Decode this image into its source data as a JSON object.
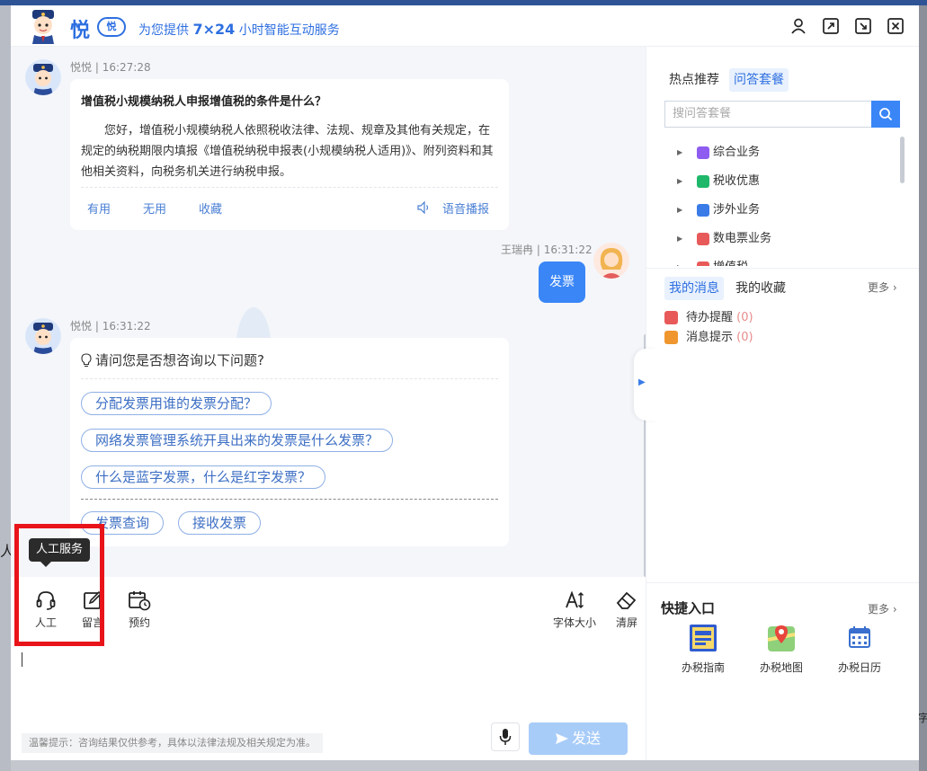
{
  "header": {
    "brand": "悦",
    "brand_badge": "悦",
    "tagline_pre": "为您提供",
    "tagline_bold": "7×24",
    "tagline_post": "小时智能互动服务"
  },
  "chat": {
    "messages": [
      {
        "sender": "悦悦",
        "time": "16:27:28",
        "question": "增值税小规模纳税人申报增值税的条件是什么？",
        "answer": "您好，增值税小规模纳税人依照税收法律、法规、规章及其他有关规定，在规定的纳税期限内填报《增值税纳税申报表(小规模纳税人适用)》、附列资料和其他相关资料，向税务机关进行纳税申报。",
        "actions": [
          "有用",
          "无用",
          "收藏"
        ],
        "voice_label": "语音播报"
      },
      {
        "sender": "王瑞冉",
        "time": "16:31:22",
        "text": "发票"
      },
      {
        "sender": "悦悦",
        "time": "16:31:22",
        "prompt": "请问您是否想咨询以下问题?",
        "suggestions": [
          "分配发票用谁的发票分配？",
          "网络发票管理系统开具出来的发票是什么发票？",
          "什么是蓝字发票，什么是红字发票？"
        ],
        "quick_chips": [
          "发票查询",
          "接收发票"
        ]
      }
    ]
  },
  "toolbar": {
    "left": [
      {
        "label": "人工",
        "icon": "headset-icon"
      },
      {
        "label": "留言",
        "icon": "edit-icon"
      },
      {
        "label": "预约",
        "icon": "calendar-clock-icon"
      }
    ],
    "right": [
      {
        "label": "字体大小",
        "icon": "font-size-icon"
      },
      {
        "label": "清屏",
        "icon": "eraser-icon"
      }
    ],
    "tooltip": "人工服务"
  },
  "input": {
    "notice": "温馨提示：咨询结果仅供参考，具体以法律法规及相关规定为准。",
    "send_label": "发送"
  },
  "right_panel": {
    "tabs": [
      "热点推荐",
      "问答套餐"
    ],
    "active_tab": "问答套餐",
    "search_placeholder": "搜问答套餐",
    "tree": [
      {
        "label": "综合业务",
        "color": "#8e5cf0"
      },
      {
        "label": "税收优惠",
        "color": "#1fb86a"
      },
      {
        "label": "涉外业务",
        "color": "#3a7be8"
      },
      {
        "label": "数电票业务",
        "color": "#e85a5a"
      },
      {
        "label": "增值税",
        "color": "#e85a5a"
      }
    ],
    "msg_tabs": [
      "我的消息",
      "我的收藏"
    ],
    "more_label": "更多",
    "messages": [
      {
        "label": "待办提醒",
        "count": "(0)",
        "color": "#e85a5a"
      },
      {
        "label": "消息提示",
        "count": "(0)",
        "color": "#f0962e"
      }
    ],
    "quick_title": "快捷入口",
    "quick_more": "更多",
    "quick_links": [
      {
        "label": "办税指南",
        "icon": "guide-book-icon"
      },
      {
        "label": "办税地图",
        "icon": "map-pin-icon"
      },
      {
        "label": "办税日历",
        "icon": "calendar-icon"
      }
    ]
  },
  "colors": {
    "primary": "#3a86f7",
    "brand_blue": "#2e6fe0",
    "highlight_red": "#e8141a"
  }
}
